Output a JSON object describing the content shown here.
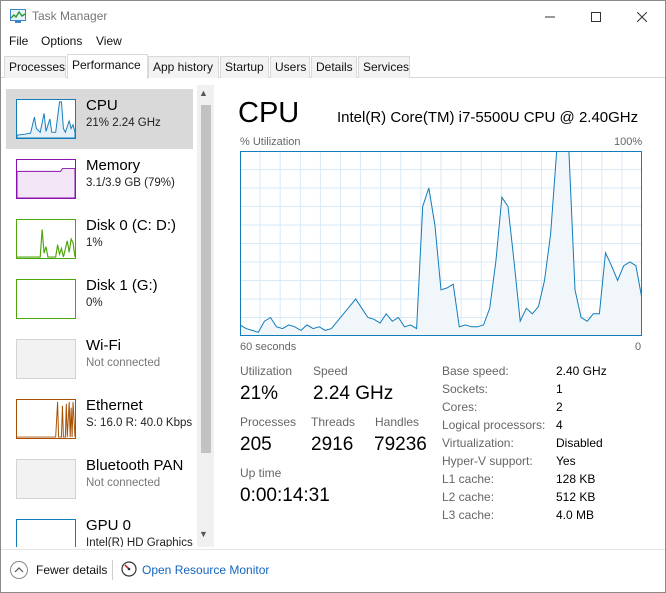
{
  "window": {
    "title": "Task Manager"
  },
  "menu": [
    "File",
    "Options",
    "View"
  ],
  "tabs": [
    "Processes",
    "Performance",
    "App history",
    "Startup",
    "Users",
    "Details",
    "Services"
  ],
  "active_tab": "Performance",
  "sidebar": {
    "items": [
      {
        "name": "CPU",
        "detail": "21% 2.24 GHz",
        "color": "#117dbb"
      },
      {
        "name": "Memory",
        "detail": "3.1/3.9 GB (79%)",
        "color": "#8b12ae"
      },
      {
        "name": "Disk 0 (C: D:)",
        "detail": "1%",
        "color": "#4da60c"
      },
      {
        "name": "Disk 1 (G:)",
        "detail": "0%",
        "color": "#4da60c"
      },
      {
        "name": "Wi-Fi",
        "detail": "Not connected",
        "color": "#a74f01"
      },
      {
        "name": "Ethernet",
        "detail": "S: 16.0  R: 40.0 Kbps",
        "color": "#a74f01"
      },
      {
        "name": "Bluetooth PAN",
        "detail": "Not connected",
        "color": "#a74f01"
      },
      {
        "name": "GPU 0",
        "detail": "Intel(R) HD Graphics",
        "color": "#117dbb"
      }
    ]
  },
  "cpu": {
    "title": "CPU",
    "model": "Intel(R) Core(TM) i7-5500U CPU @ 2.40GHz",
    "graph": {
      "util_label": "% Utilization",
      "max_label": "100%",
      "time_label": "60 seconds",
      "zero_label": "0",
      "line_color": "#117dbb",
      "fill_color": "#f1f6fa",
      "values": [
        6,
        4,
        3,
        2,
        8,
        10,
        5,
        4,
        6,
        5,
        3,
        6,
        4,
        5,
        3,
        4,
        8,
        12,
        16,
        20,
        15,
        10,
        9,
        7,
        12,
        8,
        10,
        5,
        6,
        4,
        70,
        80,
        60,
        25,
        26,
        28,
        5,
        6,
        5,
        5,
        6,
        15,
        40,
        75,
        70,
        40,
        8,
        15,
        12,
        16,
        30,
        55,
        100,
        100,
        100,
        25,
        10,
        8,
        12,
        12,
        45,
        38,
        30,
        38,
        40,
        38,
        20
      ],
      "ylim": [
        0,
        100
      ]
    },
    "stats": {
      "utilization_label": "Utilization",
      "utilization": "21%",
      "speed_label": "Speed",
      "speed": "2.24 GHz",
      "processes_label": "Processes",
      "processes": "205",
      "threads_label": "Threads",
      "threads": "2916",
      "handles_label": "Handles",
      "handles": "79236",
      "uptime_label": "Up time",
      "uptime": "0:00:14:31"
    },
    "specs": [
      {
        "key": "Base speed:",
        "value": "2.40 GHz"
      },
      {
        "key": "Sockets:",
        "value": "1"
      },
      {
        "key": "Cores:",
        "value": "2"
      },
      {
        "key": "Logical processors:",
        "value": "4"
      },
      {
        "key": "Virtualization:",
        "value": "Disabled"
      },
      {
        "key": "Hyper-V support:",
        "value": "Yes"
      },
      {
        "key": "L1 cache:",
        "value": "128 KB"
      },
      {
        "key": "L2 cache:",
        "value": "512 KB"
      },
      {
        "key": "L3 cache:",
        "value": "4.0 MB"
      }
    ]
  },
  "footer": {
    "fewer_details": "Fewer details",
    "resource_monitor": "Open Resource Monitor"
  }
}
